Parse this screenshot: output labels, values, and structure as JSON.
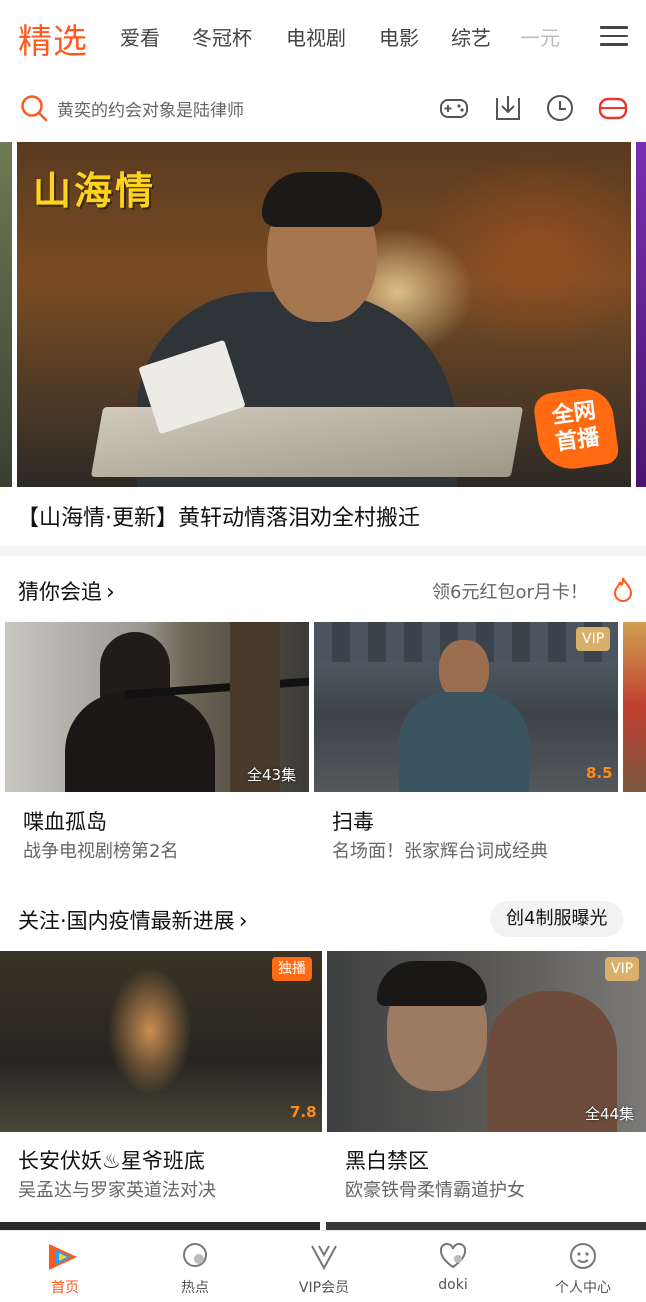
{
  "topnav": {
    "active_tab": "精选",
    "tabs": [
      "爱看",
      "冬冠杯",
      "电视剧",
      "电影",
      "综艺"
    ],
    "faded_tab": "一元",
    "accent_color": "#ff5a1e",
    "menu_icon": "hamburger-menu-icon"
  },
  "search": {
    "placeholder": "黄奕的约会对象是陆律师",
    "icon": "search-icon",
    "tools": [
      "game-controller-icon",
      "download-icon",
      "history-clock-icon",
      "tv-icon"
    ]
  },
  "banner": {
    "logo_text": "山海情",
    "badge_text_line1": "全网",
    "badge_text_line2": "首播",
    "caption": "【山海情·更新】黄轩动情落泪劝全村搬迁"
  },
  "section1": {
    "title": "猜你会追",
    "promo": "领6元红包or月卡！",
    "cards": [
      {
        "title": "喋血孤岛",
        "subtitle": "战争电视剧榜第2名",
        "episodes": "全43集"
      },
      {
        "title": "扫毒",
        "subtitle": "名场面！张家辉台词成经典",
        "badge": "VIP",
        "score": "8.5"
      }
    ]
  },
  "section2": {
    "title": "关注·国内疫情最新进展",
    "pill": "创4制服曝光",
    "cards": [
      {
        "title": "长安伏妖♨星爷班底",
        "subtitle": "吴孟达与罗家英道法对决",
        "badge": "独播",
        "score": "7.8"
      },
      {
        "title": "黑白禁区",
        "subtitle": "欧豪铁骨柔情霸道护女",
        "badge": "VIP",
        "episodes": "全44集"
      }
    ]
  },
  "bottomnav": {
    "items": [
      {
        "label": "首页",
        "icon": "home-play-icon",
        "active": true
      },
      {
        "label": "热点",
        "icon": "hot-bubble-icon"
      },
      {
        "label": "VIP会员",
        "icon": "vip-v-icon"
      },
      {
        "label": "doki",
        "icon": "doki-heart-icon"
      },
      {
        "label": "个人中心",
        "icon": "profile-face-icon"
      }
    ]
  }
}
